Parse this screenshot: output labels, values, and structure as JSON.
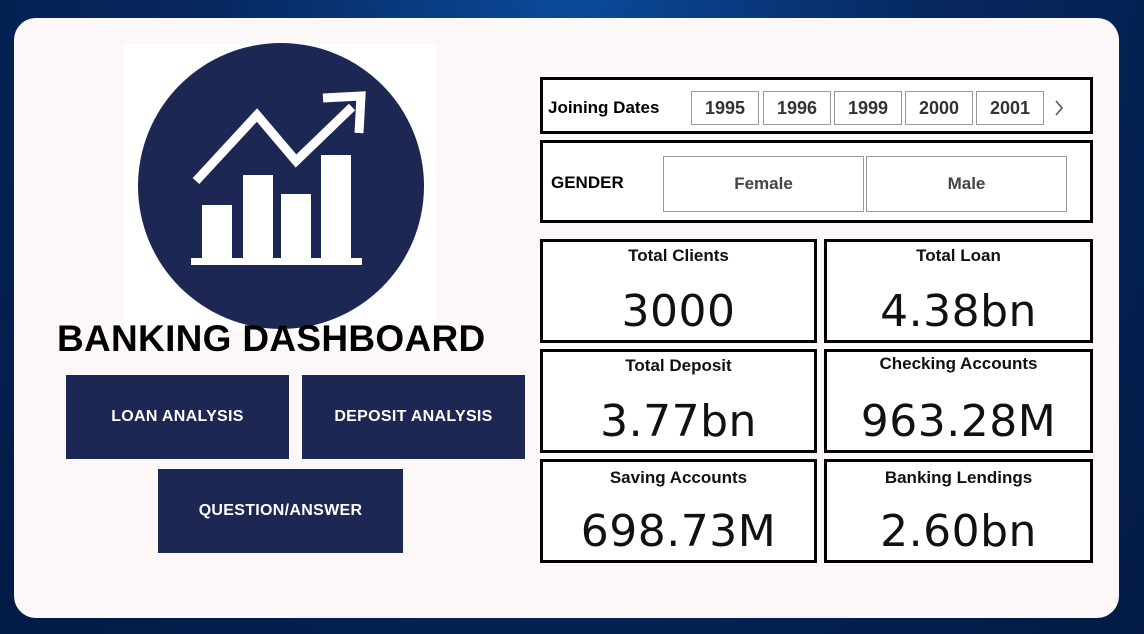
{
  "dashboard": {
    "title": "BANKING DASHBOARD",
    "logo_icon": "growth-chart-icon"
  },
  "nav": {
    "loan_label": "LOAN ANALYSIS",
    "deposit_label": "DEPOSIT ANALYSIS",
    "qa_label": "QUESTION/ANSWER"
  },
  "slicers": {
    "joining_dates": {
      "label": "Joining Dates",
      "years": [
        "1995",
        "1996",
        "1999",
        "2000",
        "2001"
      ],
      "more_icon": "chevron-right-icon"
    },
    "gender": {
      "label": "GENDER",
      "options": [
        "Female",
        "Male"
      ]
    }
  },
  "kpis": [
    {
      "label": "Total Clients",
      "value": "3000"
    },
    {
      "label": "Total Loan",
      "value": "4.38bn"
    },
    {
      "label": "Total Deposit",
      "value": "3.77bn"
    },
    {
      "label": "Checking Accounts",
      "value": "963.28M"
    },
    {
      "label": "Saving Accounts",
      "value": "698.73M"
    },
    {
      "label": "Banking Lendings",
      "value": "2.60bn"
    }
  ],
  "colors": {
    "navy": "#1c2753",
    "card_background": "#fcf8f8",
    "page_background": "#06275e"
  }
}
